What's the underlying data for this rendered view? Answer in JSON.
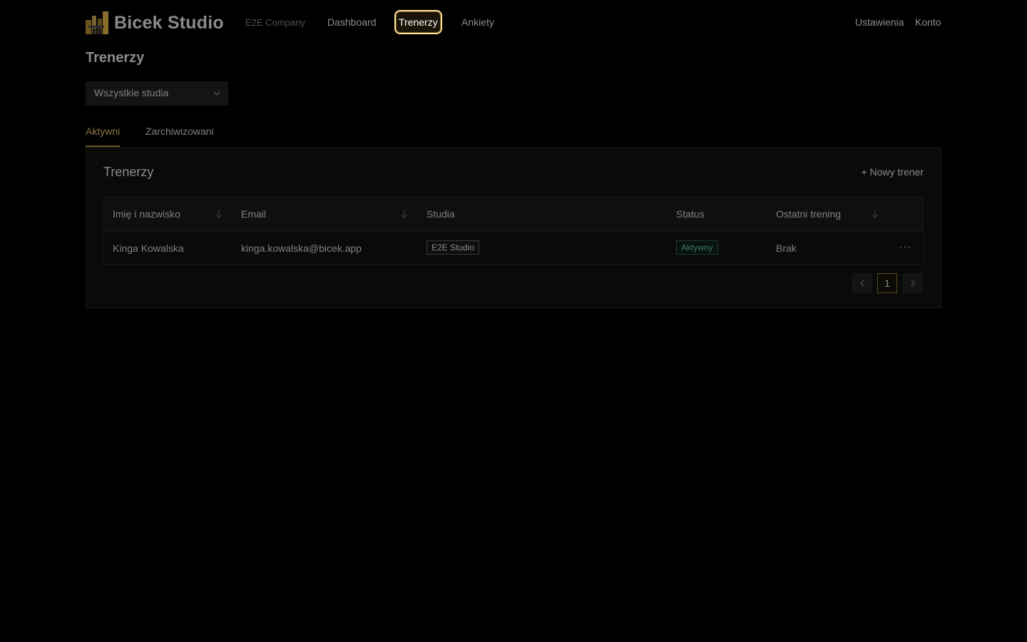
{
  "header": {
    "brand": "Bicek Studio",
    "company": "E2E Company",
    "nav": [
      {
        "label": "Dashboard",
        "active": false
      },
      {
        "label": "Trenerzy",
        "active": true
      },
      {
        "label": "Ankiety",
        "active": false
      }
    ],
    "settings_label": "Ustawienia",
    "account_label": "Konto",
    "accent_color": "#ffe29a"
  },
  "page": {
    "title": "Trenerzy",
    "studio_filter": "Wszystkie studia",
    "tabs": [
      {
        "label": "Aktywni",
        "active": true
      },
      {
        "label": "Zarchiwizowani",
        "active": false
      }
    ]
  },
  "card": {
    "title": "Trenerzy",
    "new_button": "+ Nowy trener",
    "columns": [
      "Imię i nazwisko",
      "Email",
      "Studia",
      "Status",
      "Ostatni trening"
    ],
    "rows": [
      {
        "name": "Kinga Kowalska",
        "email": "kinga.kowalska@bicek.app",
        "studio": "E2E Studio",
        "status": "Aktywny",
        "last_training": "Brak"
      }
    ],
    "pagination": {
      "current_page": "1"
    }
  },
  "icons": [
    "logo-icon",
    "chevron-down-icon",
    "sort-arrow-icon",
    "more-icon",
    "chevron-left-icon",
    "chevron-right-icon"
  ]
}
